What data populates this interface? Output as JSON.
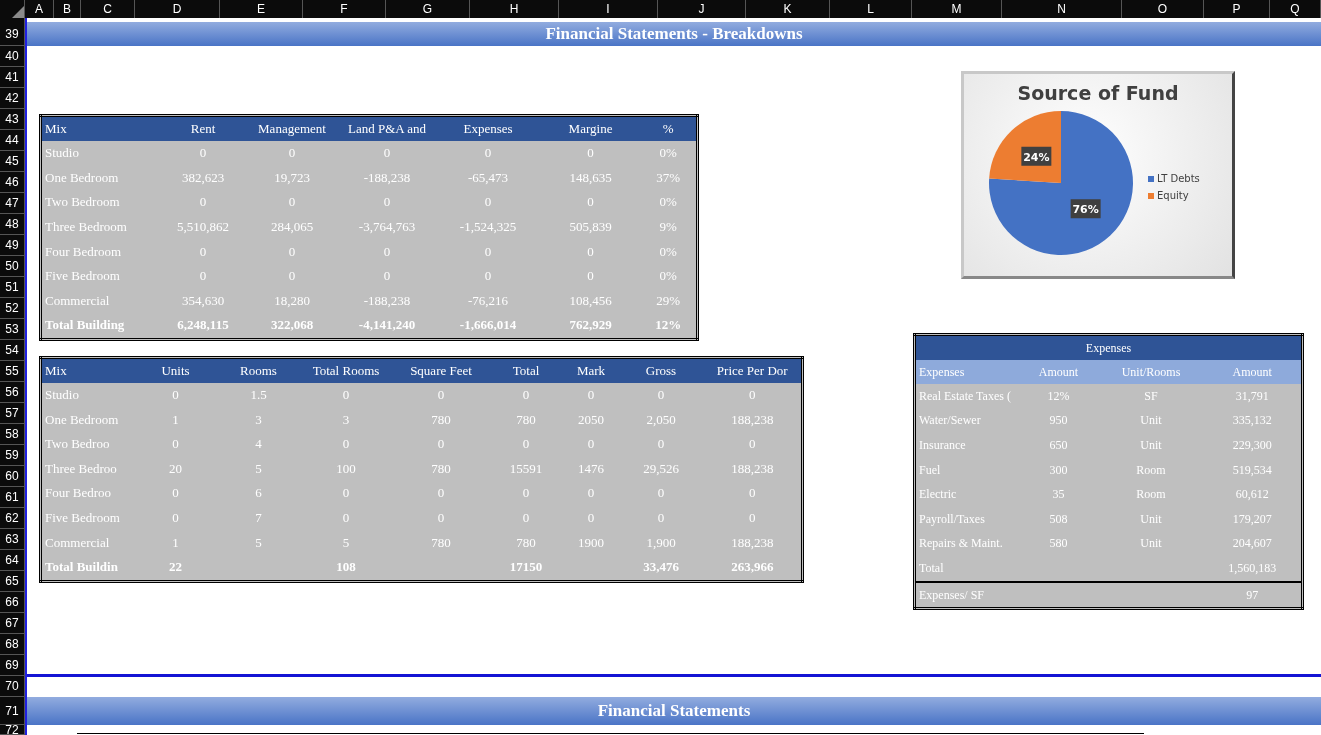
{
  "columns": [
    "A",
    "B",
    "C",
    "D",
    "E",
    "F",
    "G",
    "H",
    "I",
    "J",
    "K",
    "L",
    "M",
    "N",
    "O",
    "P",
    "Q"
  ],
  "rows": [
    "39",
    "40",
    "41",
    "42",
    "43",
    "44",
    "45",
    "46",
    "47",
    "48",
    "49",
    "50",
    "51",
    "52",
    "53",
    "54",
    "55",
    "56",
    "57",
    "58",
    "59",
    "60",
    "61",
    "62",
    "63",
    "64",
    "65",
    "66",
    "67",
    "68",
    "69",
    "70",
    "71",
    "72"
  ],
  "top_banner": {
    "title": "Financial Statements - Breakdowns"
  },
  "mix_table": {
    "columns": [
      "Mix",
      "Rent",
      "Management",
      "Land P&A and",
      "Expenses",
      "Margine",
      "%"
    ],
    "rows": [
      {
        "kind": "data",
        "cells": [
          "Studio",
          "0",
          "0",
          "0",
          "0",
          "0",
          "0%"
        ]
      },
      {
        "kind": "data",
        "cells": [
          "One Bedroom",
          "382,623",
          "19,723",
          "-188,238",
          "-65,473",
          "148,635",
          "37%"
        ]
      },
      {
        "kind": "data",
        "cells": [
          "Two Bedroom",
          "0",
          "0",
          "0",
          "0",
          "0",
          "0%"
        ]
      },
      {
        "kind": "data",
        "cells": [
          "Three Bedroom",
          "5,510,862",
          "284,065",
          "-3,764,763",
          "-1,524,325",
          "505,839",
          "9%"
        ]
      },
      {
        "kind": "data",
        "cells": [
          "Four Bedroom",
          "0",
          "0",
          "0",
          "0",
          "0",
          "0%"
        ]
      },
      {
        "kind": "data",
        "cells": [
          "Five Bedroom",
          "0",
          "0",
          "0",
          "0",
          "0",
          "0%"
        ]
      },
      {
        "kind": "data",
        "cells": [
          "Commercial",
          "354,630",
          "18,280",
          "-188,238",
          "-76,216",
          "108,456",
          "29%"
        ]
      },
      {
        "kind": "total",
        "cells": [
          "Total Building",
          "6,248,115",
          "322,068",
          "-4,141,240",
          "-1,666,014",
          "762,929",
          "12%"
        ]
      }
    ]
  },
  "units_table": {
    "columns": [
      "Mix",
      "Units",
      "Rooms",
      "Total Rooms",
      "Square Feet",
      "Total",
      "Mark",
      "Gross",
      "Price Per Dor"
    ],
    "rows": [
      {
        "kind": "data",
        "cells": [
          "Studio",
          "0",
          "1.5",
          "0",
          "0",
          "0",
          "0",
          "0",
          "0"
        ]
      },
      {
        "kind": "data",
        "cells": [
          "One Bedroom",
          "1",
          "3",
          "3",
          "780",
          "780",
          "2050",
          "2,050",
          "188,238"
        ]
      },
      {
        "kind": "data",
        "cells": [
          "Two Bedroo",
          "0",
          "4",
          "0",
          "0",
          "0",
          "0",
          "0",
          "0"
        ]
      },
      {
        "kind": "data",
        "cells": [
          "Three Bedroo",
          "20",
          "5",
          "100",
          "780",
          "15591",
          "1476",
          "29,526",
          "188,238"
        ]
      },
      {
        "kind": "data",
        "cells": [
          "Four Bedroo",
          "0",
          "6",
          "0",
          "0",
          "0",
          "0",
          "0",
          "0"
        ]
      },
      {
        "kind": "data",
        "cells": [
          "Five Bedroom",
          "0",
          "7",
          "0",
          "0",
          "0",
          "0",
          "0",
          "0"
        ]
      },
      {
        "kind": "data",
        "cells": [
          "Commercial",
          "1",
          "5",
          "5",
          "780",
          "780",
          "1900",
          "1,900",
          "188,238"
        ]
      },
      {
        "kind": "total",
        "cells": [
          "Total Buildin",
          "22",
          "",
          "108",
          "",
          "17150",
          "",
          "33,476",
          "263,966"
        ]
      }
    ]
  },
  "chart": {
    "chart_data": {
      "type": "pie",
      "title": "Source of Fund",
      "categories": [
        "LT Debts",
        "Equity"
      ],
      "values": [
        76,
        24
      ],
      "colors": [
        "#4472c4",
        "#ed7d31"
      ],
      "data_labels": true,
      "value_labels": [
        "76%",
        "24%"
      ],
      "legend": "right"
    }
  },
  "expenses_table": {
    "title": "Expenses",
    "columns": [
      "Expenses",
      "Amount",
      "Unit/Rooms",
      "Amount"
    ],
    "rows": [
      {
        "kind": "data",
        "cells": [
          "Real Estate Taxes (",
          "12%",
          "SF",
          "31,791"
        ]
      },
      {
        "kind": "data",
        "cells": [
          "Water/Sewer",
          "950",
          "Unit",
          "335,132"
        ]
      },
      {
        "kind": "data",
        "cells": [
          "Insurance",
          "650",
          "Unit",
          "229,300"
        ]
      },
      {
        "kind": "data",
        "cells": [
          "Fuel",
          "300",
          "Room",
          "519,534"
        ]
      },
      {
        "kind": "data",
        "cells": [
          "Electric",
          "35",
          "Room",
          "60,612"
        ]
      },
      {
        "kind": "data",
        "cells": [
          "Payroll/Taxes",
          "508",
          "Unit",
          "179,207"
        ]
      },
      {
        "kind": "data",
        "cells": [
          "Repairs & Maint.",
          "580",
          "Unit",
          "204,607"
        ]
      },
      {
        "kind": "data",
        "cells": [
          "Total",
          "",
          "",
          "1,560,183"
        ]
      },
      {
        "kind": "footer",
        "cells": [
          "Expenses/ SF",
          "",
          "",
          "97"
        ]
      }
    ]
  },
  "bottom_banner": {
    "title": "Financial Statements"
  }
}
